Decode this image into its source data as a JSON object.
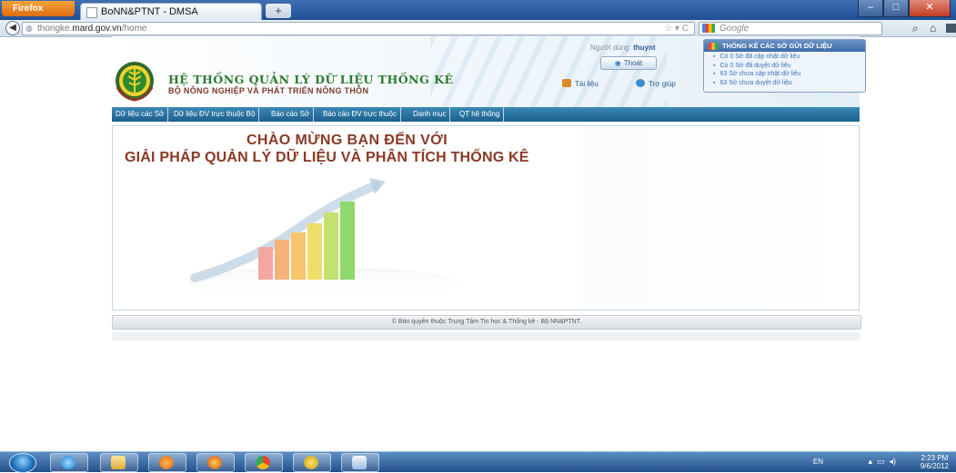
{
  "browser": {
    "app_button": "Firefox",
    "tab_title": "BoNN&PTNT - DMSA",
    "new_tab": "+",
    "url_prefix": "thongke.",
    "url_domain": "mard.gov.vn",
    "url_path": "/home",
    "search_placeholder": "Google",
    "win_min": "–",
    "win_max": "□",
    "win_close": "✕"
  },
  "header": {
    "site_title": "HỆ THỐNG QUẢN LÝ DỮ LIỆU THỐNG KÊ",
    "site_subtitle": "BỘ NÔNG NGHIỆP VÀ PHÁT TRIỂN NÔNG THÔN",
    "user_label": "Người dùng:",
    "user_name": "thuynt",
    "logout_label": "Thoát",
    "docs_label": "Tài liệu",
    "help_label": "Trợ giúp"
  },
  "stats_box": {
    "title": "THỐNG KÊ CÁC SỞ GỬI DỮ LIỆU",
    "items": [
      "Có 0 Sở đã cập nhật dữ liệu",
      "Có 0 Sở đã duyệt dữ liệu",
      "63 Sở chưa cập nhật dữ liệu",
      "63 Sở chưa duyệt dữ liệu"
    ]
  },
  "menu": [
    "Dữ liệu các Sở",
    "Dữ liệu ĐV trực thuộc Bộ",
    "Báo cáo Sở",
    "Báo cáo ĐV trực thuộc",
    "Danh mục",
    "QT hệ thống"
  ],
  "content": {
    "welcome_line1": "CHÀO MỪNG BẠN ĐẾN VỚI",
    "welcome_line2": "GIẢI PHÁP QUẢN LÝ DỮ LIỆU VÀ PHÂN TÍCH THỐNG KÊ"
  },
  "footer": {
    "copyright": "© Bản quyền thuộc Trung Tâm Tin học & Thống kê - Bộ NN&PTNT."
  },
  "taskbar": {
    "language": "EN",
    "time": "2:23 PM",
    "date": "9/6/2012"
  }
}
